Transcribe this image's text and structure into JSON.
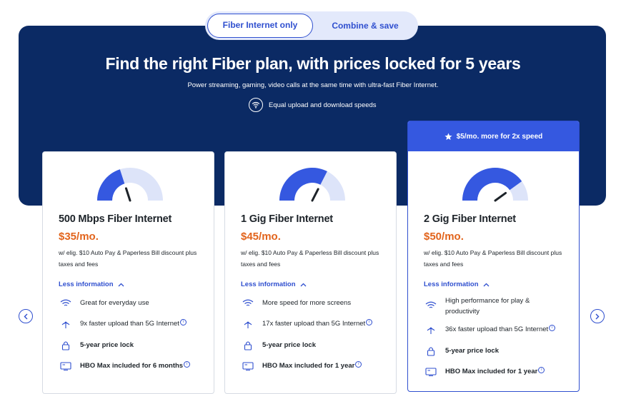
{
  "toggle": {
    "options": [
      "Fiber Internet only",
      "Combine & save"
    ],
    "selected": "Fiber Internet only"
  },
  "hero": {
    "title": "Find the right Fiber plan, with prices locked for 5 years",
    "subtitle": "Power streaming, gaming, video calls at the same time with ultra-fast Fiber Internet.",
    "feature": "Equal upload and download speeds"
  },
  "plans": [
    {
      "name": "500 Mbps Fiber Internet",
      "price": "$35/mo.",
      "fine_print": "w/ elig. $10 Auto Pay & Paperless Bill discount plus taxes and fees",
      "toggle_label": "Less information",
      "speed_level": 0.4,
      "features": [
        {
          "icon": "wifi-icon",
          "text": "Great for everyday use",
          "bold": false,
          "info": false
        },
        {
          "icon": "upload-icon",
          "text": "9x faster upload than 5G Internet",
          "bold": false,
          "info": true
        },
        {
          "icon": "lock-icon",
          "text": "5-year price lock",
          "bold": true,
          "info": false
        },
        {
          "icon": "tv-icon",
          "text": "HBO Max included for 6 months",
          "bold": true,
          "info": true
        }
      ]
    },
    {
      "name": "1 Gig Fiber Internet",
      "price": "$45/mo.",
      "fine_print": "w/ elig. $10 Auto Pay & Paperless Bill discount plus taxes and fees",
      "toggle_label": "Less information",
      "speed_level": 0.65,
      "features": [
        {
          "icon": "wifi-icon",
          "text": "More speed for more screens",
          "bold": false,
          "info": false
        },
        {
          "icon": "upload-icon",
          "text": "17x faster upload than 5G Internet",
          "bold": false,
          "info": true
        },
        {
          "icon": "lock-icon",
          "text": "5-year price lock",
          "bold": true,
          "info": false
        },
        {
          "icon": "tv-icon",
          "text": "HBO Max included for 1 year",
          "bold": true,
          "info": true
        }
      ]
    },
    {
      "name": "2 Gig Fiber Internet",
      "price": "$50/mo.",
      "fine_print": "w/ elig. $10 Auto Pay & Paperless Bill discount plus taxes and fees",
      "toggle_label": "Less information",
      "banner": "$5/mo. more for 2x speed",
      "speed_level": 0.8,
      "features": [
        {
          "icon": "wifi-icon",
          "text": "High performance for play & productivity",
          "bold": false,
          "info": false
        },
        {
          "icon": "upload-icon",
          "text": "36x faster upload than 5G Internet",
          "bold": false,
          "info": true
        },
        {
          "icon": "lock-icon",
          "text": "5-year price lock",
          "bold": true,
          "info": false
        },
        {
          "icon": "tv-icon",
          "text": "HBO Max included for 1 year",
          "bold": true,
          "info": true
        }
      ]
    }
  ],
  "colors": {
    "navy": "#0b2a64",
    "accent": "#2f4fcf",
    "price": "#e2641c",
    "gauge_fill": "#3558e0",
    "gauge_track": "#dde4f9"
  },
  "carousel": {
    "prev_icon": "chevron-left-icon",
    "next_icon": "chevron-right-icon"
  }
}
